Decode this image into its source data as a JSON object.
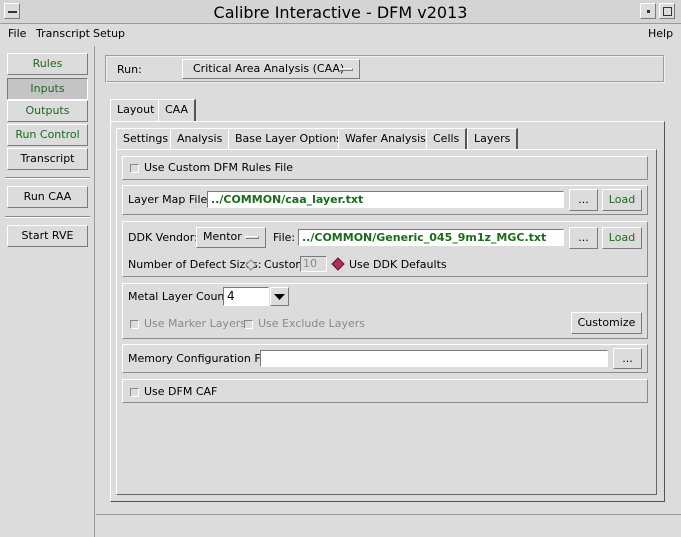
{
  "window": {
    "title": "Calibre Interactive - DFM v2013"
  },
  "menubar": {
    "file": "File",
    "transcript": "Transcript",
    "setup": "Setup",
    "help": "Help"
  },
  "sidebar": {
    "rules": "Rules",
    "inputs": "Inputs",
    "outputs": "Outputs",
    "run_control": "Run Control",
    "transcript": "Transcript",
    "run_caa": "Run CAA",
    "start_rve": "Start RVE"
  },
  "run": {
    "label": "Run:",
    "value": "Critical Area Analysis (CAA)"
  },
  "top_tabs": [
    "Layout",
    "CAA"
  ],
  "sub_tabs": [
    "Settings",
    "Analysis",
    "Base Layer Options",
    "Wafer Analysis",
    "Cells",
    "Layers"
  ],
  "settings": {
    "custom_rules_label": "Use Custom DFM Rules File",
    "layer_map_label": "Layer Map File:",
    "layer_map_value": "../COMMON/caa_layer.txt",
    "browse_label": "...",
    "load_label": "Load",
    "ddk_vendor_label": "DDK Vendor:",
    "ddk_vendor_value": "Mentor",
    "file_label": "File:",
    "ddk_file_value": "../COMMON/Generic_045_9m1z_MGC.txt",
    "defect_sizes_label": "Number of Defect Sizes:",
    "custom_label": "Custom",
    "custom_value": "10",
    "ddk_defaults_label": "Use DDK Defaults",
    "metal_count_label": "Metal Layer Count:",
    "metal_count_value": "4",
    "marker_layers_label": "Use Marker Layers",
    "exclude_layers_label": "Use Exclude Layers",
    "customize_label": "Customize",
    "memory_config_label": "Memory Configuration File:",
    "memory_config_value": "",
    "dfm_caf_label": "Use DFM CAF"
  },
  "colors": {
    "accent_green": "#1a6b1a",
    "diamond": "#b0305a"
  }
}
